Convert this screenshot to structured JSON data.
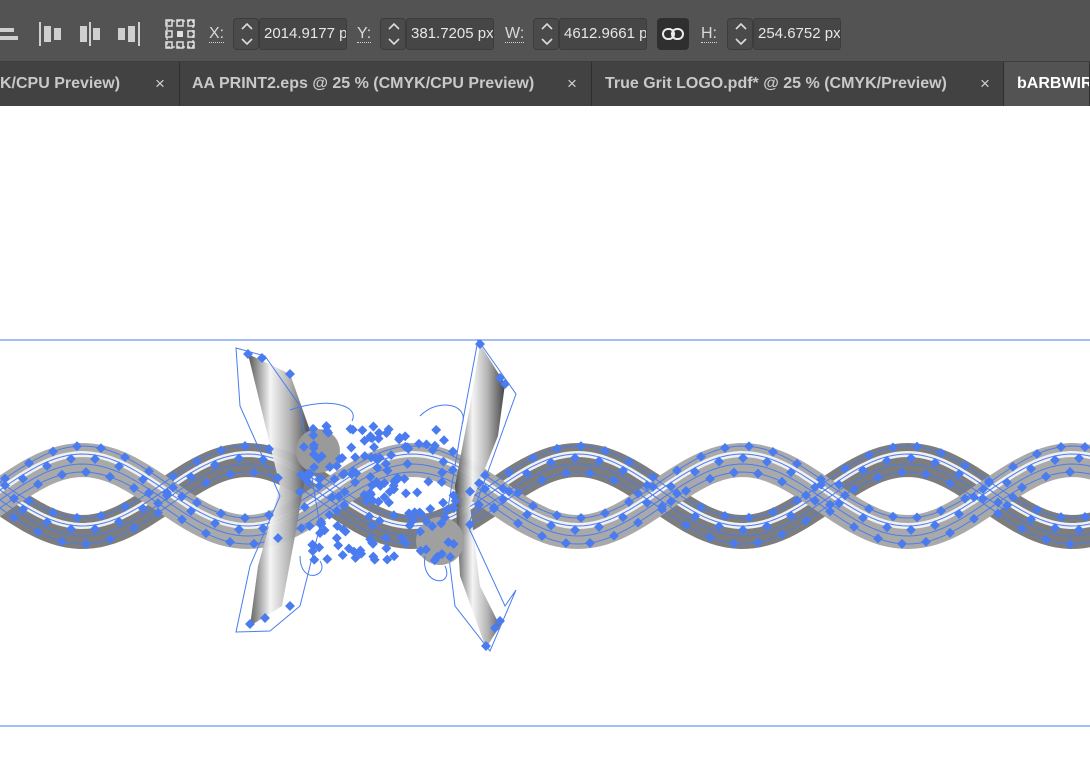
{
  "control_bar": {
    "x": {
      "label": "X:",
      "value": "2014.9177 p"
    },
    "y": {
      "label": "Y:",
      "value": "381.7205 px"
    },
    "w": {
      "label": "W:",
      "value": "4612.9661 p"
    },
    "h": {
      "label": "H:",
      "value": "254.6752 px"
    }
  },
  "tabs": [
    {
      "label": "K/CPU Preview)",
      "close": "×"
    },
    {
      "label": "AA PRINT2.eps @ 25 % (CMYK/CPU Preview)",
      "close": "×"
    },
    {
      "label": "True Grit LOGO.pdf* @ 25 % (CMYK/Preview)",
      "close": "×"
    },
    {
      "label": "bARBWIR",
      "active": true
    }
  ],
  "colors": {
    "selection": "#4a7cf0",
    "toolbar_bg": "#535353",
    "tab_bg": "#424242",
    "active_tab_bg": "#535353"
  }
}
